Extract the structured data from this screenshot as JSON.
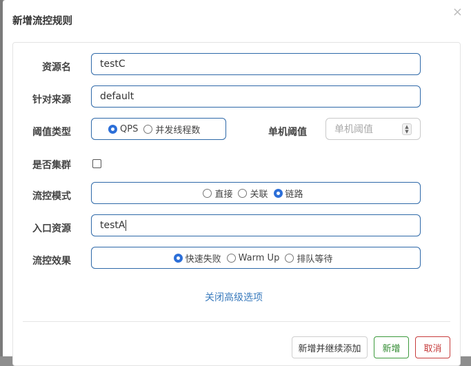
{
  "dialog": {
    "title": "新增流控规则",
    "close_icon": "×"
  },
  "form": {
    "resource_name": {
      "label": "资源名",
      "value": "testC"
    },
    "limit_app": {
      "label": "针对来源",
      "value": "default"
    },
    "grade": {
      "label": "阈值类型",
      "options": [
        "QPS",
        "并发线程数"
      ],
      "selected": "QPS"
    },
    "threshold": {
      "label": "单机阈值",
      "placeholder": "单机阈值",
      "spinner_icon": "⌃⌄"
    },
    "cluster": {
      "label": "是否集群",
      "checked": false
    },
    "strategy": {
      "label": "流控模式",
      "options": [
        "直接",
        "关联",
        "链路"
      ],
      "selected": "链路"
    },
    "entry_resource": {
      "label": "入口资源",
      "value": "testA"
    },
    "control_behavior": {
      "label": "流控效果",
      "options": [
        "快速失败",
        "Warm Up",
        "排队等待"
      ],
      "selected": "快速失败"
    },
    "advanced_toggle": "关闭高级选项"
  },
  "footer": {
    "add_continue_label": "新增并继续添加",
    "add_label": "新增",
    "cancel_label": "取消"
  }
}
